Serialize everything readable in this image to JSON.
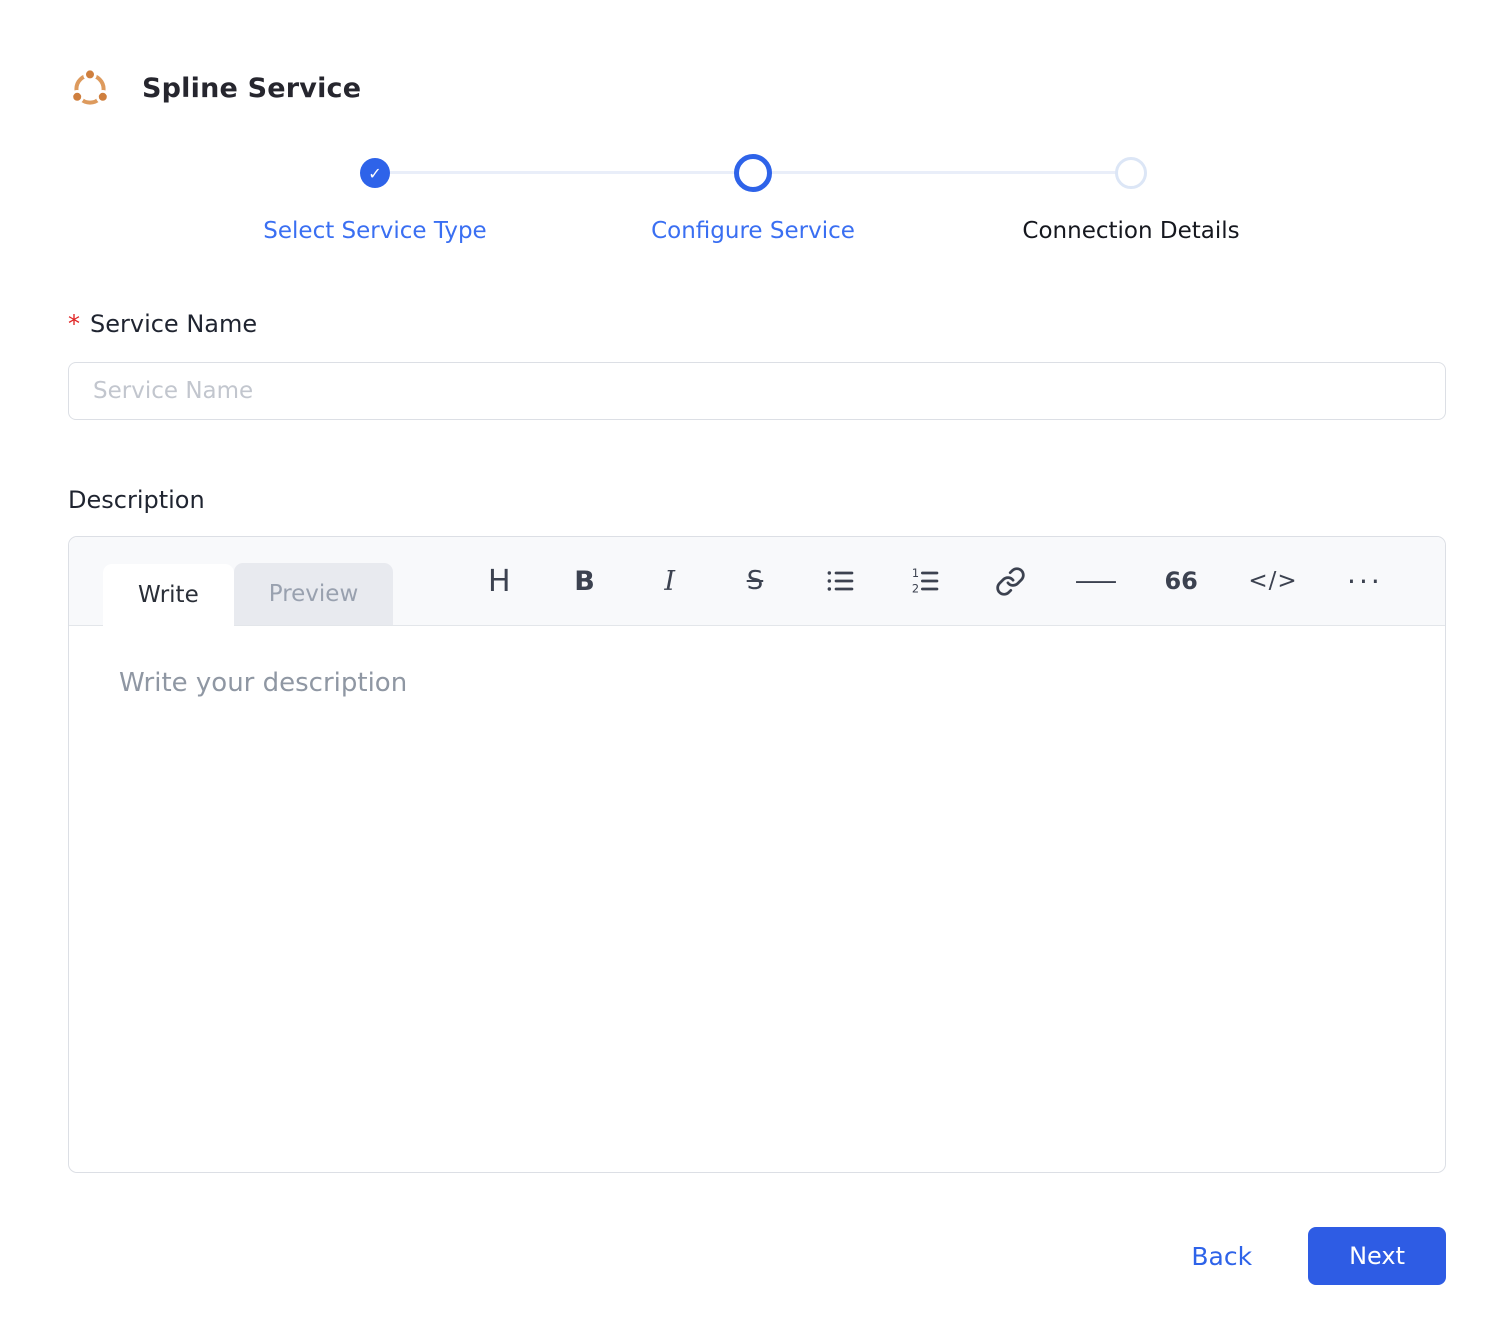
{
  "header": {
    "title": "Spline Service",
    "logo_icon": "network-nodes-icon"
  },
  "stepper": {
    "check_glyph": "✓",
    "steps": [
      {
        "label": "Select Service Type",
        "state": "completed"
      },
      {
        "label": "Configure Service",
        "state": "active"
      },
      {
        "label": "Connection Details",
        "state": "upcoming"
      }
    ]
  },
  "form": {
    "service_name": {
      "required_marker": "*",
      "label": "Service Name",
      "placeholder": "Service Name",
      "value": ""
    },
    "description": {
      "label": "Description",
      "tabs": [
        {
          "label": "Write",
          "active": true
        },
        {
          "label": "Preview",
          "active": false
        }
      ],
      "toolbar": [
        {
          "name": "heading",
          "glyph": "H"
        },
        {
          "name": "bold",
          "glyph": "B"
        },
        {
          "name": "italic",
          "glyph": "I"
        },
        {
          "name": "strikethrough",
          "glyph": "S"
        },
        {
          "name": "bullet-list",
          "glyph": ""
        },
        {
          "name": "ordered-list",
          "glyph": ""
        },
        {
          "name": "link",
          "glyph": ""
        },
        {
          "name": "horizontal-rule",
          "glyph": "—"
        },
        {
          "name": "quote",
          "glyph": "66"
        },
        {
          "name": "code",
          "glyph": "</>"
        },
        {
          "name": "more",
          "glyph": "···"
        }
      ],
      "placeholder": "Write your description",
      "value": ""
    }
  },
  "footer": {
    "back_label": "Back",
    "next_label": "Next"
  },
  "colors": {
    "accent_blue": "#2e5ce4",
    "step_blue": "#3a6ff2",
    "required_red": "#e02424",
    "toolbar_icon_gray": "#3c4250",
    "logo_orange": "#d98a47"
  }
}
